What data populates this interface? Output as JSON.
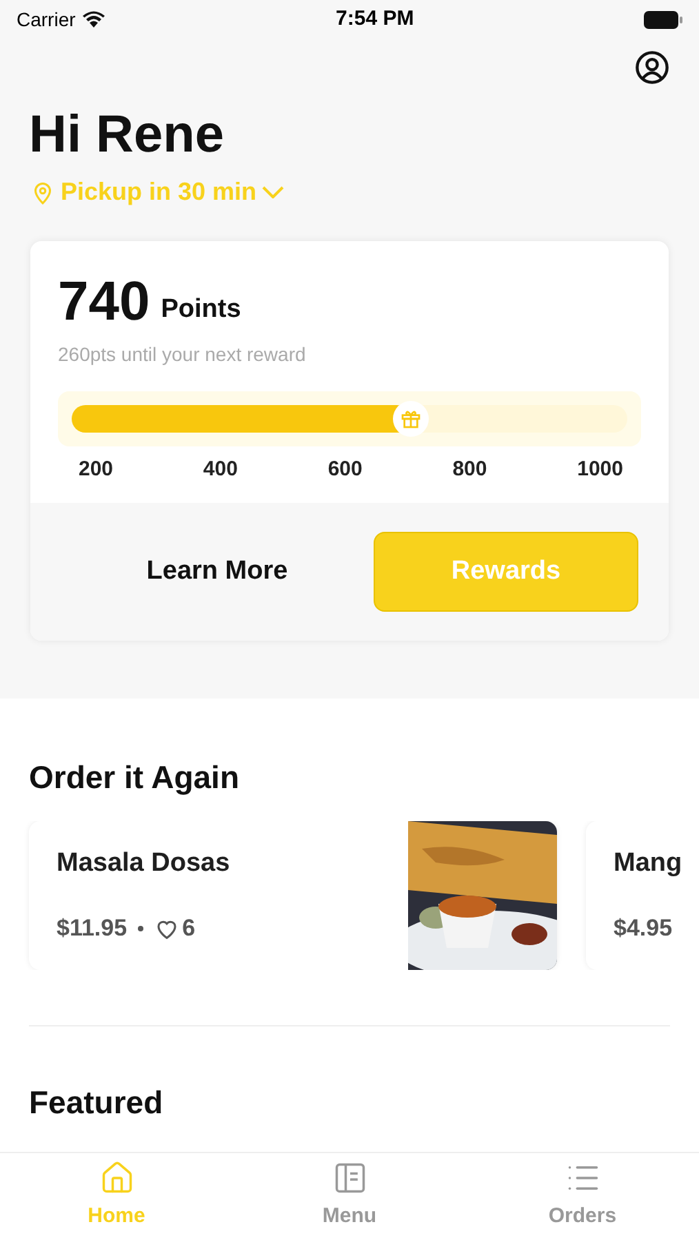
{
  "status_bar": {
    "carrier": "Carrier",
    "time": "7:54 PM"
  },
  "greeting": "Hi Rene",
  "pickup": "Pickup in 30 min",
  "rewards_card": {
    "points": "740",
    "points_label": "Points",
    "subtitle": "260pts until your next reward",
    "level": 0.61,
    "ticks": [
      "200",
      "400",
      "600",
      "800",
      "1000"
    ],
    "learn_more": "Learn More",
    "rewards_button": "Rewards"
  },
  "order_again": {
    "title": "Order it Again",
    "items": [
      {
        "name": "Masala Dosas",
        "price": "$11.95",
        "likes": "6",
        "kind": "picture"
      },
      {
        "name": "Mang",
        "price": "$4.95"
      }
    ]
  },
  "featured": {
    "title": "Featured"
  },
  "tabs": [
    {
      "label": "Home",
      "selected": true,
      "kind": "home"
    },
    {
      "label": "Menu",
      "selected": false,
      "kind": "menu"
    },
    {
      "label": "Orders",
      "selected": false,
      "kind": "orders"
    }
  ]
}
